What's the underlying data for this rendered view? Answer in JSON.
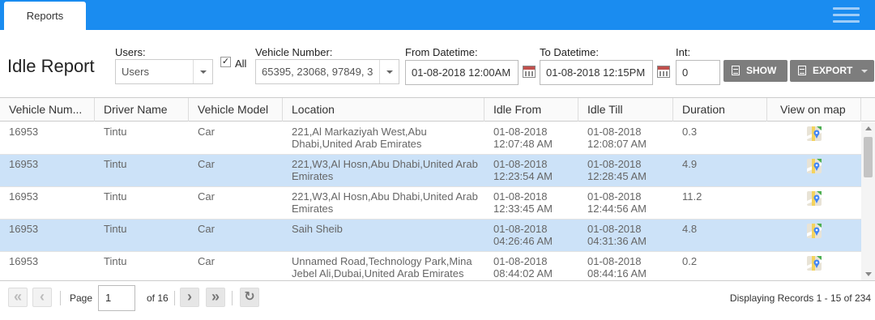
{
  "tab": {
    "label": "Reports"
  },
  "page_title": "Idle Report",
  "filters": {
    "users_label": "Users:",
    "users_value": "Users",
    "all_label": "All",
    "all_checked": true,
    "vehicle_label": "Vehicle Number:",
    "vehicle_value": "65395, 23068, 97849, 3",
    "from_label": "From Datetime:",
    "from_value": "01-08-2018 12:00AM",
    "to_label": "To Datetime:",
    "to_value": "01-08-2018 12:15PM",
    "int_label": "Int:",
    "int_value": "0",
    "show_label": "SHOW",
    "export_label": "EXPORT"
  },
  "columns": [
    "Vehicle Num...",
    "Driver Name",
    "Vehicle Model",
    "Location",
    "Idle From",
    "Idle Till",
    "Duration",
    "View on map"
  ],
  "rows": [
    {
      "vehicle": "16953",
      "driver": "Tintu",
      "model": "Car",
      "location": "221,Al Markaziyah West,Abu Dhabi,United Arab Emirates",
      "from_d": "01-08-2018",
      "from_t": "12:07:48 AM",
      "till_d": "01-08-2018",
      "till_t": "12:08:07 AM",
      "duration": "0.3"
    },
    {
      "vehicle": "16953",
      "driver": "Tintu",
      "model": "Car",
      "location": "221,W3,Al Hosn,Abu Dhabi,United Arab Emirates",
      "from_d": "01-08-2018",
      "from_t": "12:23:54 AM",
      "till_d": "01-08-2018",
      "till_t": "12:28:45 AM",
      "duration": "4.9"
    },
    {
      "vehicle": "16953",
      "driver": "Tintu",
      "model": "Car",
      "location": "221,W3,Al Hosn,Abu Dhabi,United Arab Emirates",
      "from_d": "01-08-2018",
      "from_t": "12:33:45 AM",
      "till_d": "01-08-2018",
      "till_t": "12:44:56 AM",
      "duration": "11.2"
    },
    {
      "vehicle": "16953",
      "driver": "Tintu",
      "model": "Car",
      "location": "Saih Sheib",
      "from_d": "01-08-2018",
      "from_t": "04:26:46 AM",
      "till_d": "01-08-2018",
      "till_t": "04:31:36 AM",
      "duration": "4.8"
    },
    {
      "vehicle": "16953",
      "driver": "Tintu",
      "model": "Car",
      "location": "Unnamed Road,Technology Park,Mina Jebel Ali,Dubai,United Arab Emirates",
      "from_d": "01-08-2018",
      "from_t": "08:44:02 AM",
      "till_d": "01-08-2018",
      "till_t": "08:44:16 AM",
      "duration": "0.2"
    }
  ],
  "pager": {
    "page_label": "Page",
    "page_value": "1",
    "of_label": "of 16",
    "records": "Displaying Records 1 - 15 of 234"
  },
  "colors": {
    "topbar": "#1a8cf0",
    "selected_row": "#cce2f8",
    "button": "#7d7d7d"
  },
  "icons": [
    "menu-icon",
    "calendar-icon",
    "document-icon",
    "google-maps-icon",
    "first-page-icon",
    "prev-page-icon",
    "next-page-icon",
    "last-page-icon",
    "refresh-icon"
  ]
}
